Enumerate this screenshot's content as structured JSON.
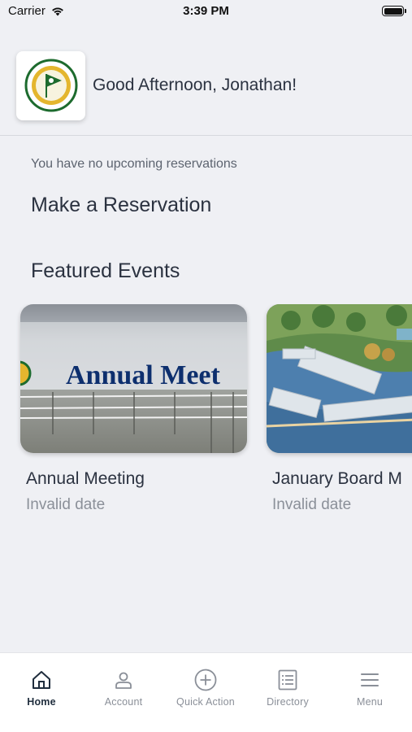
{
  "status_bar": {
    "carrier": "Carrier",
    "time": "3:39 PM"
  },
  "header": {
    "logo_text_top": "CEDAR CREEK",
    "logo_text_bottom": "YACHT CLUB",
    "greeting": "Good Afternoon, Jonathan!"
  },
  "reservations": {
    "empty_message": "You have no upcoming reservations",
    "make_heading": "Make a Reservation"
  },
  "featured": {
    "heading": "Featured Events",
    "events": [
      {
        "title": "Annual Meeting",
        "date": "Invalid date",
        "banner_text": "Annual Meet"
      },
      {
        "title": "January Board M",
        "date": "Invalid date"
      }
    ]
  },
  "tabbar": {
    "tabs": [
      {
        "label": "Home",
        "icon": "home-icon",
        "active": true
      },
      {
        "label": "Account",
        "icon": "person-icon"
      },
      {
        "label": "Quick Action",
        "icon": "plus-circle-icon"
      },
      {
        "label": "Directory",
        "icon": "list-icon"
      },
      {
        "label": "Menu",
        "icon": "hamburger-menu-icon"
      }
    ]
  },
  "colors": {
    "background": "#eff0f4",
    "text": "#2b3240",
    "muted": "#8b9099",
    "logo_green": "#1d6b2e",
    "logo_gold": "#e4b62e",
    "banner_blue": "#0d2f6e"
  }
}
